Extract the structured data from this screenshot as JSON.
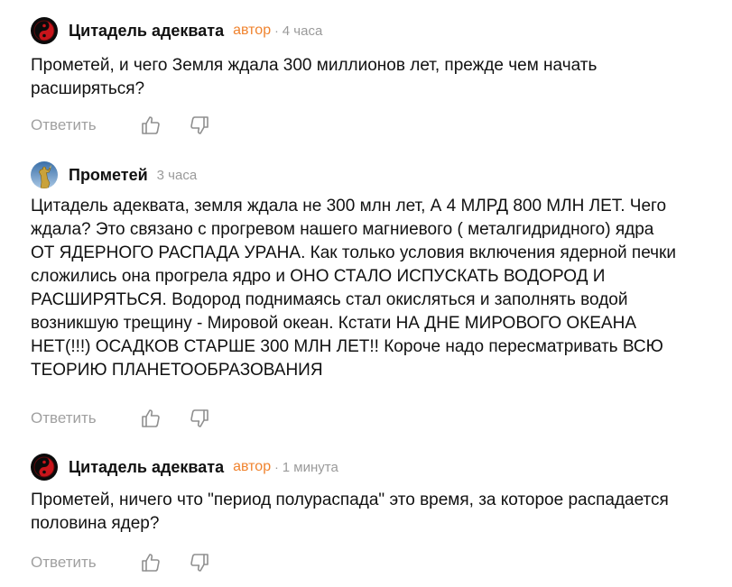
{
  "colors": {
    "author_badge": "#f0832e",
    "muted": "#9a9a9a",
    "text": "#111111"
  },
  "comments": [
    {
      "avatar_icon": "yin-yang-red-avatar-icon",
      "author_name": "Цитадель адеквата",
      "badge": "автор",
      "separator": "·",
      "time": "4 часа",
      "text": "Прометей, и чего Земля ждала 300 миллионов лет, прежде чем начать\nрасширяться?",
      "reply_label": "Ответить",
      "like_icon": "thumbs-up-icon",
      "dislike_icon": "thumbs-down-icon"
    },
    {
      "avatar_icon": "statue-avatar-icon",
      "author_name": "Прометей",
      "time": "3 часа",
      "text": "Цитадель адеквата, земля ждала не 300 млн лет, А 4 МЛРД 800 МЛН ЛЕТ. Чего\nждала? Это связано с прогревом нашего магниевого ( металгидридного) ядра\nОТ ЯДЕРНОГО РАСПАДА УРАНА. Как только условия включения ядерной печки\nсложились она прогрела ядро и ОНО СТАЛО ИСПУСКАТЬ ВОДОРОД И\nРАСШИРЯТЬСЯ. Водород поднимаясь стал окисляться и заполнять водой\nвозникшую трещину - Мировой океан. Кстати НА ДНЕ МИРОВОГО ОКЕАНА\nНЕТ(!!!) ОСАДКОВ СТАРШЕ 300 МЛН ЛЕТ!! Короче надо пересматривать ВСЮ\nТЕОРИЮ ПЛАНЕТООБРАЗОВАНИЯ",
      "reply_label": "Ответить",
      "like_icon": "thumbs-up-icon",
      "dislike_icon": "thumbs-down-icon"
    },
    {
      "avatar_icon": "yin-yang-red-avatar-icon",
      "author_name": "Цитадель адеквата",
      "badge": "автор",
      "separator": "·",
      "time": "1 минута",
      "text": "Прометей, ничего что \"период полураспада\" это время, за которое распадается\nполовина ядер?",
      "reply_label": "Ответить",
      "like_icon": "thumbs-up-icon",
      "dislike_icon": "thumbs-down-icon"
    }
  ]
}
